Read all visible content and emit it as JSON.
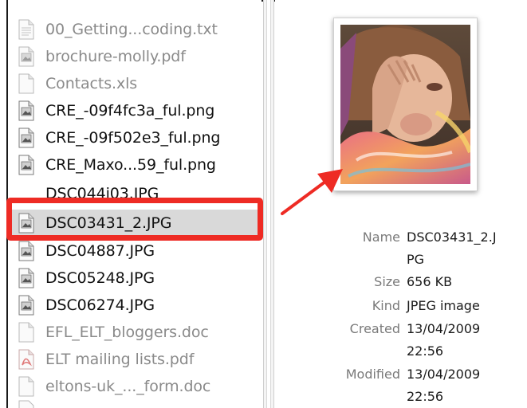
{
  "file_list": {
    "items": [
      {
        "name": "00_Getting...coding.txt",
        "icon": "text-file-icon",
        "dimmed": true
      },
      {
        "name": "brochure-molly.pdf",
        "icon": "image-file-icon",
        "dimmed": true
      },
      {
        "name": "Contacts.xls",
        "icon": "blank-file-icon",
        "dimmed": true
      },
      {
        "name": "CRE_-09f4fc3a_ful.png",
        "icon": "image-file-icon",
        "dimmed": false
      },
      {
        "name": "CRE_-09f502e3_ful.png",
        "icon": "image-file-icon",
        "dimmed": false
      },
      {
        "name": "CRE_Maxo...59_ful.png",
        "icon": "image-file-icon",
        "dimmed": false
      },
      {
        "name": "DSC03431_2.JPG",
        "icon": "image-file-icon",
        "dimmed": false,
        "selected": true
      },
      {
        "name": "DSC04887.JPG",
        "icon": "image-file-icon",
        "dimmed": false
      },
      {
        "name": "DSC05248.JPG",
        "icon": "image-file-icon",
        "dimmed": false
      },
      {
        "name": "DSC06274.JPG",
        "icon": "image-file-icon",
        "dimmed": false
      },
      {
        "name": "EFL_ELT_bloggers.doc",
        "icon": "blank-file-icon",
        "dimmed": true
      },
      {
        "name": "ELT mailing lists.pdf",
        "icon": "pdf-file-icon",
        "dimmed": true
      },
      {
        "name": "eltons-uk_..._form.doc",
        "icon": "blank-file-icon",
        "dimmed": true
      }
    ],
    "partial_item": "DSC044i03.JPG"
  },
  "preview": {
    "info": {
      "name_key": "Name",
      "name_val_1": "DSC03431_2.J",
      "name_val_2": "PG",
      "size_key": "Size",
      "size_val": "656 KB",
      "kind_key": "Kind",
      "kind_val": "JPEG image",
      "created_key": "Created",
      "created_val_1": "13/04/2009",
      "created_val_2": "22:56",
      "modified_key": "Modified",
      "modified_val_1": "13/04/2009",
      "modified_val_2": "22:56"
    }
  },
  "colors": {
    "highlight": "#ee2b24",
    "arrow": "#ee2b24",
    "selected_row": "#d9d9d9"
  }
}
